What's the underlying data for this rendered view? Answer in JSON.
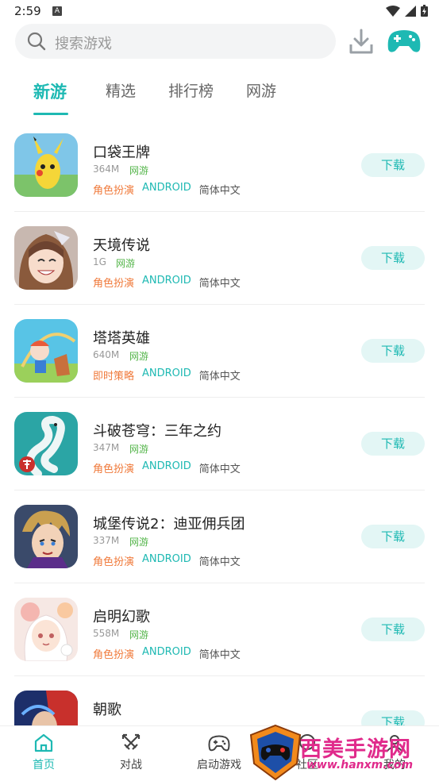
{
  "status_bar": {
    "time": "2:59",
    "notice_icon": "A"
  },
  "search": {
    "placeholder": "搜索游戏"
  },
  "tabs": [
    {
      "label": "新游",
      "active": true
    },
    {
      "label": "精选",
      "active": false
    },
    {
      "label": "排行榜",
      "active": false
    },
    {
      "label": "网游",
      "active": false
    }
  ],
  "games": [
    {
      "name": "口袋王牌",
      "size": "364M",
      "type": "网游",
      "genre": "角色扮演",
      "platform": "ANDROID",
      "language": "简体中文",
      "button": "下载"
    },
    {
      "name": "天境传说",
      "size": "1G",
      "type": "网游",
      "genre": "角色扮演",
      "platform": "ANDROID",
      "language": "简体中文",
      "button": "下载"
    },
    {
      "name": "塔塔英雄",
      "size": "640M",
      "type": "网游",
      "genre": "即时策略",
      "platform": "ANDROID",
      "language": "简体中文",
      "button": "下载"
    },
    {
      "name": "斗破苍穹：三年之约",
      "size": "347M",
      "type": "网游",
      "genre": "角色扮演",
      "platform": "ANDROID",
      "language": "简体中文",
      "button": "下载"
    },
    {
      "name": "城堡传说2：迪亚佣兵团",
      "size": "337M",
      "type": "网游",
      "genre": "角色扮演",
      "platform": "ANDROID",
      "language": "简体中文",
      "button": "下载"
    },
    {
      "name": "启明幻歌",
      "size": "558M",
      "type": "网游",
      "genre": "角色扮演",
      "platform": "ANDROID",
      "language": "简体中文",
      "button": "下载"
    },
    {
      "name": "朝歌",
      "size": "",
      "type": "",
      "genre": "",
      "platform": "",
      "language": "",
      "button": "下载"
    }
  ],
  "bottom_nav": [
    {
      "label": "首页",
      "icon": "home-icon",
      "active": true
    },
    {
      "label": "对战",
      "icon": "swords-icon",
      "active": false
    },
    {
      "label": "启动游戏",
      "icon": "gamepad-icon",
      "active": false
    },
    {
      "label": "社区",
      "icon": "community-icon",
      "active": false
    },
    {
      "label": "我的",
      "icon": "profile-icon",
      "active": false
    }
  ],
  "watermark": {
    "title": "西美手游网",
    "url": "www.hanxm.com"
  },
  "colors": {
    "accent": "#1eb9b3",
    "genre": "#f07a3b",
    "net": "#54b54a"
  }
}
